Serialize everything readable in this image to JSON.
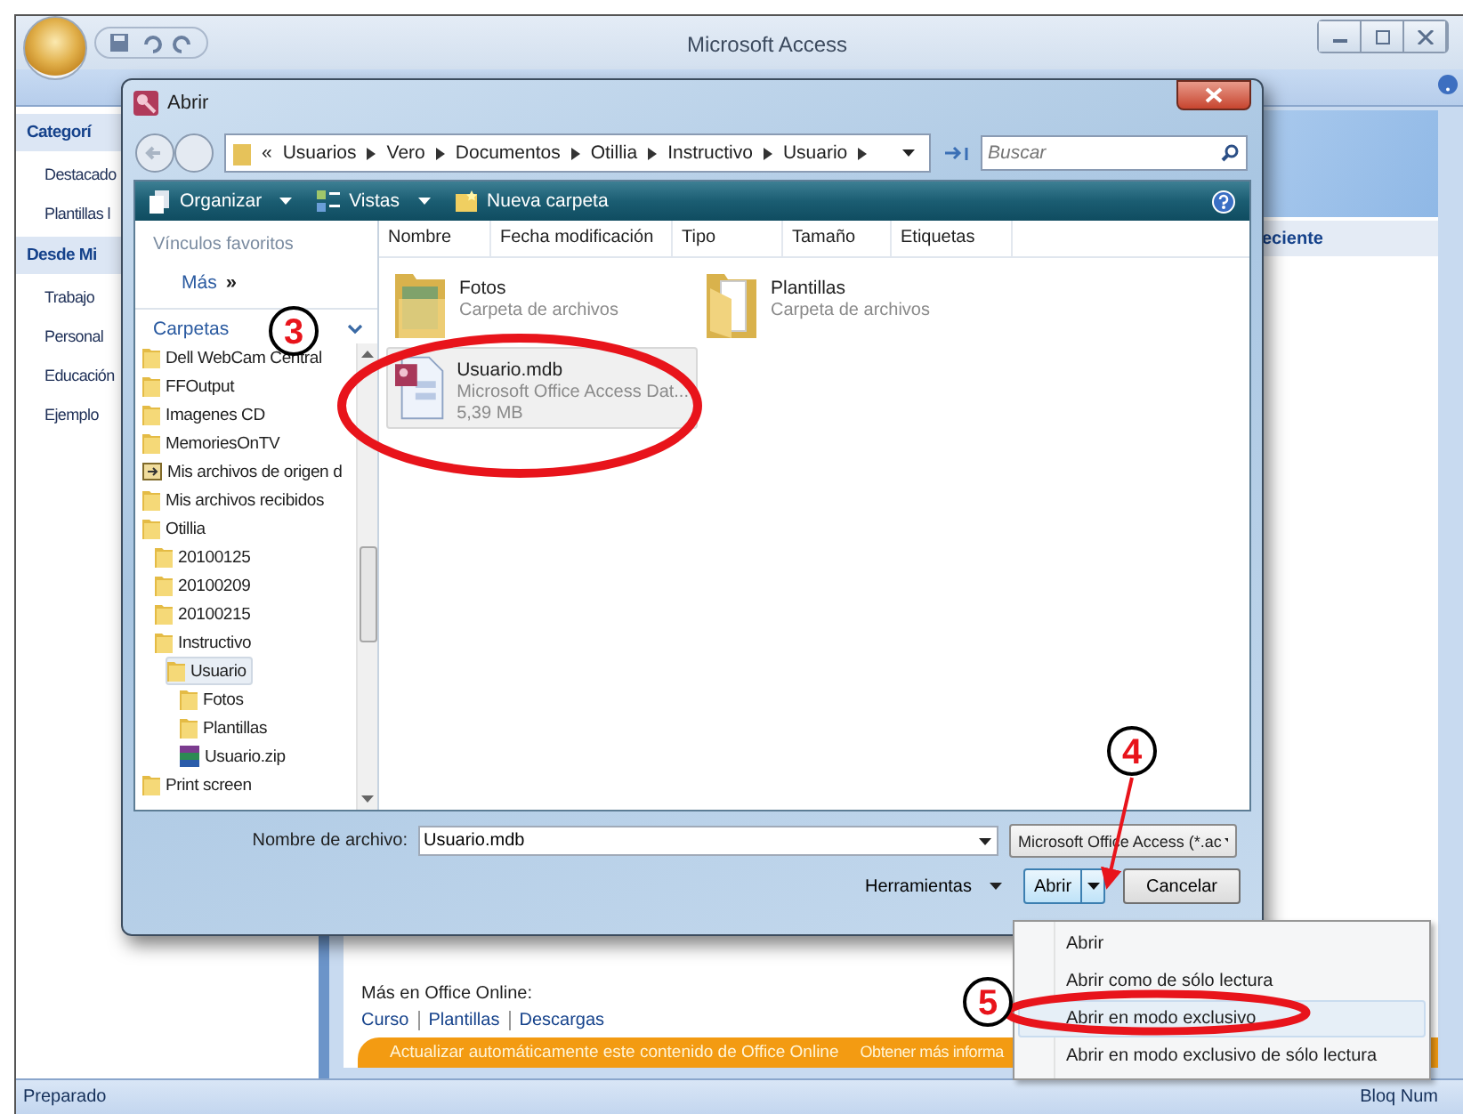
{
  "app": {
    "title": "Microsoft Access",
    "status": "Preparado",
    "status_right": "Bloq Num"
  },
  "categories": [
    {
      "label": "Categorí",
      "kind": "header"
    },
    {
      "label": "Destacado",
      "kind": "item"
    },
    {
      "label": "Plantillas l",
      "kind": "item"
    },
    {
      "label": "Desde Mi",
      "kind": "header"
    },
    {
      "label": "Trabajo",
      "kind": "item"
    },
    {
      "label": "Personal",
      "kind": "item"
    },
    {
      "label": "Educación",
      "kind": "item"
    },
    {
      "label": "Ejemplo",
      "kind": "item"
    }
  ],
  "recent_header": "eciente",
  "office_online": {
    "heading": "Más en Office Online:",
    "links": [
      "Curso",
      "Plantillas",
      "Descargas"
    ],
    "banner": "Actualizar automáticamente este contenido de Office Online",
    "banner_link": "Obtener más informa"
  },
  "dialog": {
    "title": "Abrir",
    "overflow": "«",
    "breadcrumb": [
      "Usuarios",
      "Vero",
      "Documentos",
      "Otillia",
      "Instructivo",
      "Usuario"
    ],
    "search": {
      "placeholder": "Buscar"
    },
    "toolbar": [
      {
        "label": "Organizar",
        "dropdown": true,
        "kind": "organize"
      },
      {
        "label": "Vistas",
        "dropdown": true,
        "kind": "views"
      },
      {
        "label": "Nueva carpeta",
        "dropdown": false,
        "kind": "new-folder"
      }
    ],
    "favorites_heading": "Vínculos favoritos",
    "more": "Más",
    "more_glyph": "»",
    "folders_heading": "Carpetas",
    "tree": [
      {
        "name": "Dell WebCam Central",
        "kind": "folder",
        "selected": false
      },
      {
        "name": "FFOutput",
        "kind": "folder",
        "selected": false
      },
      {
        "name": "Imagenes CD",
        "kind": "folder",
        "selected": false
      },
      {
        "name": "MemoriesOnTV",
        "kind": "folder",
        "selected": false
      },
      {
        "name": "Mis archivos de origen d",
        "kind": "shared",
        "selected": false
      },
      {
        "name": "Mis archivos recibidos",
        "kind": "folder",
        "selected": false
      },
      {
        "name": "Otillia",
        "kind": "folder",
        "selected": false,
        "children": [
          {
            "name": "20100125",
            "kind": "folder",
            "selected": false
          },
          {
            "name": "20100209",
            "kind": "folder",
            "selected": false
          },
          {
            "name": "20100215",
            "kind": "folder",
            "selected": false
          },
          {
            "name": "Instructivo",
            "kind": "folder",
            "selected": false,
            "children": [
              {
                "name": "Usuario",
                "kind": "folder",
                "selected": true,
                "children": [
                  {
                    "name": "Fotos",
                    "kind": "folder",
                    "selected": false
                  },
                  {
                    "name": "Plantillas",
                    "kind": "folder",
                    "selected": false
                  },
                  {
                    "name": "Usuario.zip",
                    "kind": "archive",
                    "selected": false
                  }
                ]
              }
            ]
          }
        ]
      },
      {
        "name": "Print screen",
        "kind": "folder",
        "selected": false
      }
    ],
    "columns": [
      "Nombre",
      "Fecha modificación",
      "Tipo",
      "Tamaño",
      "Etiquetas"
    ],
    "files": [
      {
        "name": "Fotos",
        "details": [
          "Carpeta de archivos"
        ],
        "kind": "photo-folder",
        "selected": false
      },
      {
        "name": "Plantillas",
        "details": [
          "Carpeta de archivos"
        ],
        "kind": "folder",
        "selected": false
      },
      {
        "name": "Usuario.mdb",
        "details": [
          "Microsoft Office Access Dat...",
          "5,39 MB"
        ],
        "kind": "database",
        "selected": true
      }
    ],
    "filename_label": "Nombre de archivo:",
    "filename": "Usuario.mdb",
    "filter": "Microsoft Office Access (*.ac",
    "tools": "Herramientas",
    "open": "Abrir",
    "cancel": "Cancelar"
  },
  "open_menu": [
    {
      "label": "Abrir",
      "selected": false
    },
    {
      "label": "Abrir como de sólo lectura",
      "selected": false
    },
    {
      "label": "Abrir en modo exclusivo",
      "selected": true
    },
    {
      "label": "Abrir en modo exclusivo de sólo lectura",
      "selected": false
    }
  ],
  "annotations": [
    {
      "label": "3"
    },
    {
      "label": "4"
    },
    {
      "label": "5"
    }
  ]
}
